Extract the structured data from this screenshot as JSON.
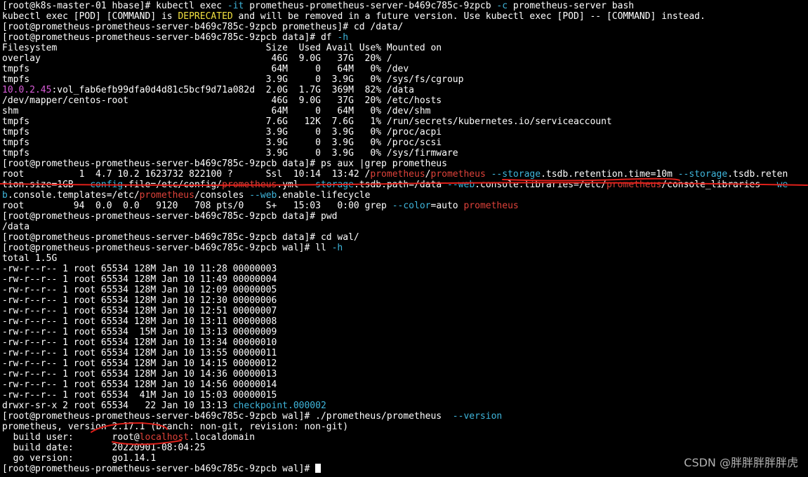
{
  "colors": {
    "background": "#000000",
    "text": "#ffffff",
    "option_flag": "#3fb6dc",
    "warning": "#f0e040",
    "ip_highlight": "#d95cd9",
    "grep_match": "#e0423a",
    "annotation": "#e0201a"
  },
  "lines": [
    [
      {
        "t": "[root@k8s-master-01 hbase]# kubectl exec "
      },
      {
        "t": "-it",
        "c": "cyan"
      },
      {
        "t": " prometheus-prometheus-server-b469c785c-9zpcb "
      },
      {
        "t": "-c",
        "c": "cyan"
      },
      {
        "t": " prometheus-server bash"
      }
    ],
    [
      {
        "t": "kubectl exec [POD] [COMMAND] is "
      },
      {
        "t": "DEPRECATED",
        "c": "yellow"
      },
      {
        "t": " and will be removed in a future version. Use kubectl exec [POD] -- [COMMAND] instead."
      }
    ],
    [
      {
        "t": "[root@prometheus-prometheus-server-b469c785c-9zpcb prometheus]# cd /data/"
      }
    ],
    [
      {
        "t": "[root@prometheus-prometheus-server-b469c785c-9zpcb data]# df "
      },
      {
        "t": "-h",
        "c": "cyan"
      }
    ],
    [
      {
        "t": "Filesystem                                      Size  Used Avail Use% Mounted on"
      }
    ],
    [
      {
        "t": "overlay                                          46G  9.0G   37G  20% /"
      }
    ],
    [
      {
        "t": "tmpfs                                            64M     0   64M   0% /dev"
      }
    ],
    [
      {
        "t": "tmpfs                                           3.9G     0  3.9G   0% /sys/fs/cgroup"
      }
    ],
    [
      {
        "t": "10.0.2.45",
        "c": "magenta"
      },
      {
        "t": ":vol_fab6efb99dfa0d4d81c5bcf9d71a082d  2.0G  1.7G  369M  82% /data"
      }
    ],
    [
      {
        "t": "/dev/mapper/centos-root                          46G  9.0G   37G  20% /etc/hosts"
      }
    ],
    [
      {
        "t": "shm                                              64M     0   64M   0% /dev/shm"
      }
    ],
    [
      {
        "t": "tmpfs                                           7.6G   12K  7.6G   1% /run/secrets/kubernetes.io/serviceaccount"
      }
    ],
    [
      {
        "t": "tmpfs                                           3.9G     0  3.9G   0% /proc/acpi"
      }
    ],
    [
      {
        "t": "tmpfs                                           3.9G     0  3.9G   0% /proc/scsi"
      }
    ],
    [
      {
        "t": "tmpfs                                           3.9G     0  3.9G   0% /sys/firmware"
      }
    ],
    [
      {
        "t": "[root@prometheus-prometheus-server-b469c785c-9zpcb data]# ps aux |grep prometheus"
      }
    ],
    [
      {
        "t": "root          1  4.7 10.2 1623732 822100 ?      Ssl  10:14  13:42 /"
      },
      {
        "t": "prometheus",
        "c": "red"
      },
      {
        "t": "/"
      },
      {
        "t": "prometheus",
        "c": "red"
      },
      {
        "t": " "
      },
      {
        "t": "--storage",
        "c": "cyan"
      },
      {
        "t": ".tsdb.retention.time=10m "
      },
      {
        "t": "--storage",
        "c": "cyan"
      },
      {
        "t": ".tsdb.reten"
      }
    ],
    [
      {
        "t": "tion.size=1GB "
      },
      {
        "t": "--config",
        "c": "cyan"
      },
      {
        "t": ".file=/etc/config/"
      },
      {
        "t": "prometheus",
        "c": "red"
      },
      {
        "t": ".yml "
      },
      {
        "t": "--storage",
        "c": "cyan"
      },
      {
        "t": ".tsdb.path=/data "
      },
      {
        "t": "--web",
        "c": "cyan"
      },
      {
        "t": ".console.libraries=/etc/"
      },
      {
        "t": "prometheus",
        "c": "red"
      },
      {
        "t": "/console_libraries "
      },
      {
        "t": "--we",
        "c": "cyan"
      }
    ],
    [
      {
        "t": "b",
        "c": "cyan"
      },
      {
        "t": ".console.templates=/etc/"
      },
      {
        "t": "prometheus",
        "c": "red"
      },
      {
        "t": "/consoles "
      },
      {
        "t": "--web",
        "c": "cyan"
      },
      {
        "t": ".enable-lifecycle"
      }
    ],
    [
      {
        "t": "root         94  0.0  0.0   9120   708 pts/0    S+   15:03   0:00 grep "
      },
      {
        "t": "--color",
        "c": "cyan"
      },
      {
        "t": "=auto "
      },
      {
        "t": "prometheus",
        "c": "red"
      }
    ],
    [
      {
        "t": "[root@prometheus-prometheus-server-b469c785c-9zpcb data]# pwd"
      }
    ],
    [
      {
        "t": "/data"
      }
    ],
    [
      {
        "t": "[root@prometheus-prometheus-server-b469c785c-9zpcb data]# cd wal/"
      }
    ],
    [
      {
        "t": "[root@prometheus-prometheus-server-b469c785c-9zpcb wal]# ll "
      },
      {
        "t": "-h",
        "c": "cyan"
      }
    ],
    [
      {
        "t": "total 1.5G"
      }
    ],
    [
      {
        "t": "-rw-r--r-- 1 root 65534 128M Jan 10 11:28 00000003"
      }
    ],
    [
      {
        "t": "-rw-r--r-- 1 root 65534 128M Jan 10 11:49 00000004"
      }
    ],
    [
      {
        "t": "-rw-r--r-- 1 root 65534 128M Jan 10 12:09 00000005"
      }
    ],
    [
      {
        "t": "-rw-r--r-- 1 root 65534 128M Jan 10 12:30 00000006"
      }
    ],
    [
      {
        "t": "-rw-r--r-- 1 root 65534 128M Jan 10 12:51 00000007"
      }
    ],
    [
      {
        "t": "-rw-r--r-- 1 root 65534 128M Jan 10 13:11 00000008"
      }
    ],
    [
      {
        "t": "-rw-r--r-- 1 root 65534  15M Jan 10 13:13 00000009"
      }
    ],
    [
      {
        "t": "-rw-r--r-- 1 root 65534 128M Jan 10 13:34 00000010"
      }
    ],
    [
      {
        "t": "-rw-r--r-- 1 root 65534 128M Jan 10 13:55 00000011"
      }
    ],
    [
      {
        "t": "-rw-r--r-- 1 root 65534 128M Jan 10 14:15 00000012"
      }
    ],
    [
      {
        "t": "-rw-r--r-- 1 root 65534 128M Jan 10 14:36 00000013"
      }
    ],
    [
      {
        "t": "-rw-r--r-- 1 root 65534 128M Jan 10 14:56 00000014"
      }
    ],
    [
      {
        "t": "-rw-r--r-- 1 root 65534  41M Jan 10 15:03 00000015"
      }
    ],
    [
      {
        "t": "drwxr-sr-x 2 root 65534   22 Jan 10 13:13 "
      },
      {
        "t": "checkpoint.000002",
        "c": "cyan"
      }
    ],
    [
      {
        "t": "[root@prometheus-prometheus-server-b469c785c-9zpcb wal]# ./prometheus/prometheus  "
      },
      {
        "t": "--version",
        "c": "cyan"
      }
    ],
    [
      {
        "t": "prometheus, version 2.17.1 (branch: non-git, revision: non-git)"
      }
    ],
    [
      {
        "t": "  build user:       root@"
      },
      {
        "t": "localhost",
        "c": "red"
      },
      {
        "t": ".localdomain"
      }
    ],
    [
      {
        "t": "  build date:       20220901-08:04:25"
      }
    ],
    [
      {
        "t": "  go version:       go1.14.1"
      }
    ],
    [
      {
        "t": "[root@prometheus-prometheus-server-b469c785c-9zpcb wal]# "
      },
      {
        "cursor": true
      }
    ]
  ],
  "watermark": "CSDN @胖胖胖胖胖虎"
}
